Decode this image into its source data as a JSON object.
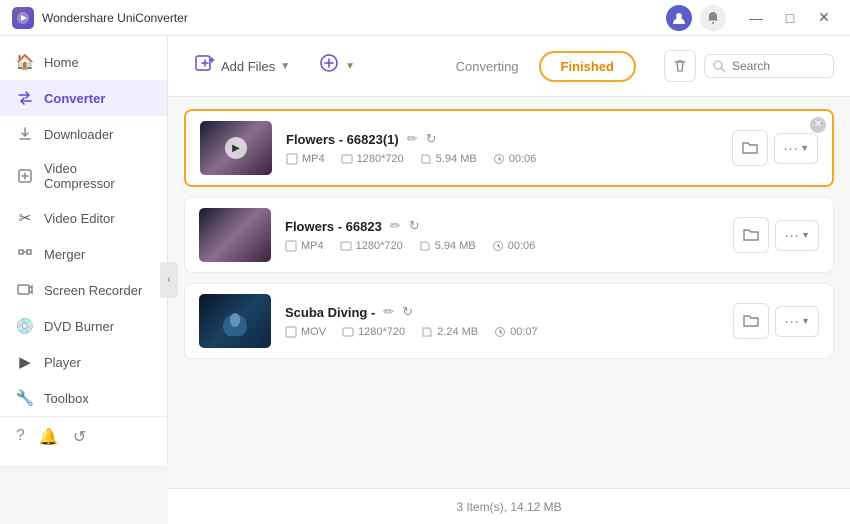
{
  "app": {
    "title": "Wondershare UniConverter",
    "logo_text": "W"
  },
  "titlebar": {
    "minimize": "—",
    "maximize": "□",
    "close": "✕"
  },
  "sidebar": {
    "items": [
      {
        "id": "home",
        "label": "Home",
        "icon": "🏠",
        "active": false
      },
      {
        "id": "converter",
        "label": "Converter",
        "icon": "⇄",
        "active": true
      },
      {
        "id": "downloader",
        "label": "Downloader",
        "icon": "↓",
        "active": false
      },
      {
        "id": "video-compressor",
        "label": "Video Compressor",
        "icon": "⊡",
        "active": false
      },
      {
        "id": "video-editor",
        "label": "Video Editor",
        "icon": "✂",
        "active": false
      },
      {
        "id": "merger",
        "label": "Merger",
        "icon": "⊕",
        "active": false
      },
      {
        "id": "screen-recorder",
        "label": "Screen Recorder",
        "icon": "⬜",
        "active": false
      },
      {
        "id": "dvd-burner",
        "label": "DVD Burner",
        "icon": "💿",
        "active": false
      },
      {
        "id": "player",
        "label": "Player",
        "icon": "▶",
        "active": false
      },
      {
        "id": "toolbox",
        "label": "Toolbox",
        "icon": "🔧",
        "active": false
      }
    ],
    "bottom_icons": [
      "?",
      "🔔",
      "↺"
    ]
  },
  "toolbar": {
    "add_files_label": "Add Files",
    "add_files_icon": "📁",
    "add_format_label": "",
    "converting_tab": "Converting",
    "finished_tab": "Finished",
    "search_placeholder": "Search"
  },
  "files": [
    {
      "id": 1,
      "title": "Flowers - 66823(1)",
      "format": "MP4",
      "resolution": "1280*720",
      "size": "5.94 MB",
      "duration": "00:06",
      "thumb_class": "file-thumb-flowers1",
      "highlighted": true,
      "has_play": true
    },
    {
      "id": 2,
      "title": "Flowers - 66823",
      "format": "MP4",
      "resolution": "1280*720",
      "size": "5.94 MB",
      "duration": "00:06",
      "thumb_class": "file-thumb-flowers2",
      "highlighted": false,
      "has_play": false
    },
    {
      "id": 3,
      "title": "Scuba Diving -",
      "format": "MOV",
      "resolution": "1280*720",
      "size": "2.24 MB",
      "duration": "00:07",
      "thumb_class": "file-thumb-scuba",
      "highlighted": false,
      "has_play": false
    }
  ],
  "status_bar": {
    "text": "3 Item(s), 14.12 MB"
  }
}
